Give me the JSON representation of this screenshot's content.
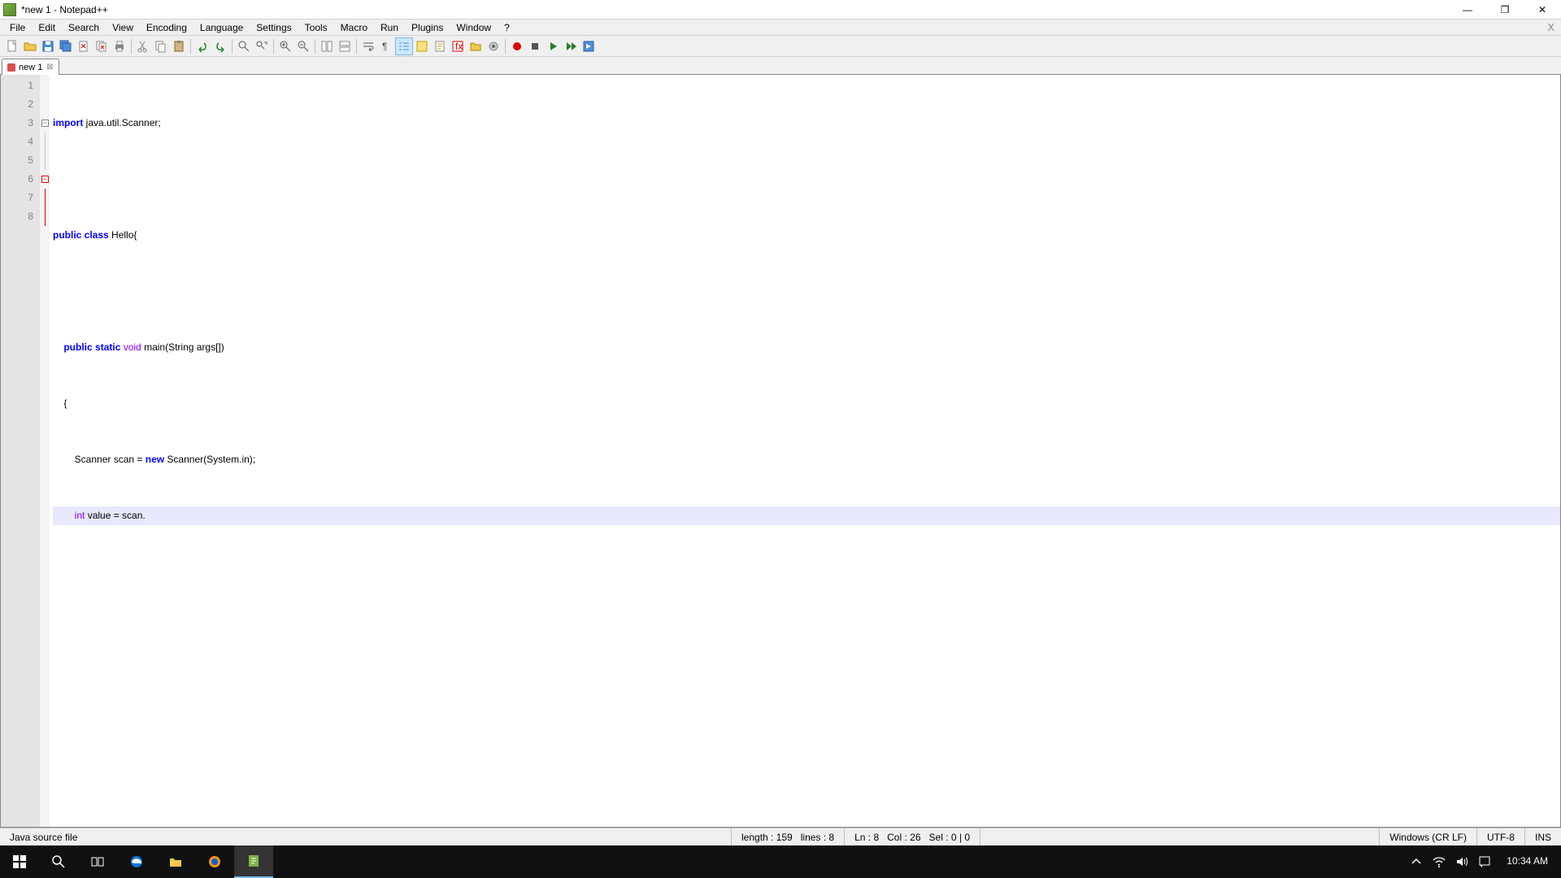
{
  "window": {
    "title": "*new 1 - Notepad++",
    "minimize": "—",
    "maximize": "❐",
    "close": "✕"
  },
  "menus": [
    "File",
    "Edit",
    "Search",
    "View",
    "Encoding",
    "Language",
    "Settings",
    "Tools",
    "Macro",
    "Run",
    "Plugins",
    "Window",
    "?"
  ],
  "tab": {
    "label": "new 1"
  },
  "line_numbers": [
    "1",
    "2",
    "3",
    "4",
    "5",
    "6",
    "7",
    "8"
  ],
  "code": {
    "l1_kw": "import",
    "l1_rest": " java.util.Scanner;",
    "l2": "",
    "l3_kw1": "public",
    "l3_kw2": " class",
    "l3_rest": " Hello{",
    "l4": "",
    "l5_pre": "    ",
    "l5_kw1": "public",
    "l5_kw2": " static",
    "l5_tp": " void",
    "l5_rest": " main(String args[])",
    "l6": "    {",
    "l7_pre": "        Scanner scan = ",
    "l7_kw": "new",
    "l7_rest": " Scanner(System.in);",
    "l8_pre": "        ",
    "l8_tp": "int",
    "l8_rest": " value = scan."
  },
  "status": {
    "file_type": "Java source file",
    "length": "length : 159",
    "lines": "lines : 8",
    "ln": "Ln : 8",
    "col": "Col : 26",
    "sel": "Sel : 0 | 0",
    "eol": "Windows (CR LF)",
    "encoding": "UTF-8",
    "mode": "INS"
  },
  "taskbar": {
    "time": "10:34 AM"
  }
}
